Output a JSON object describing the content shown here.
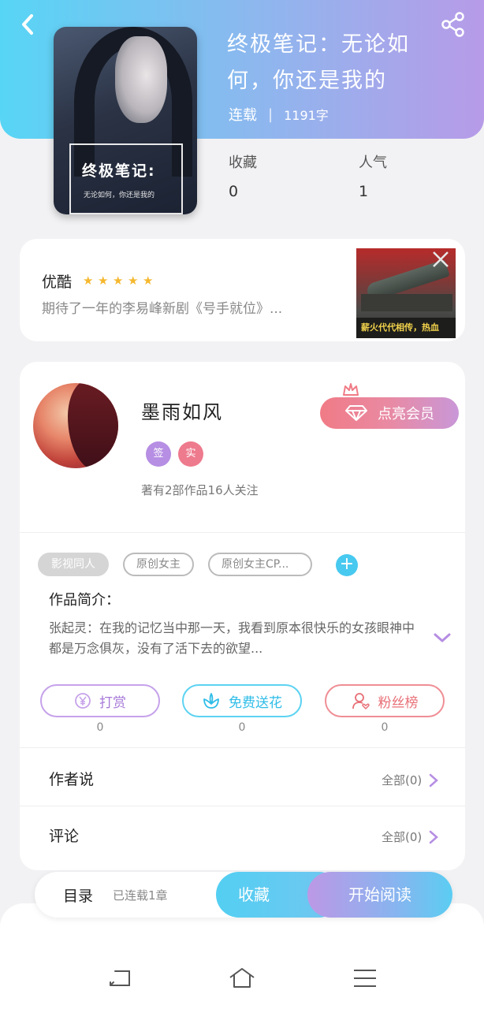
{
  "header": {
    "book_title": "终极笔记：无论如何，你还是我的",
    "status": "连载",
    "word_count": "1191字",
    "cover": {
      "title": "终极笔记:",
      "subtitle": "无论如何，你还是我的"
    }
  },
  "stats": {
    "favorites_label": "收藏",
    "favorites_value": "0",
    "popularity_label": "人气",
    "popularity_value": "1"
  },
  "ad": {
    "brand": "优酷",
    "rating": 5,
    "description": "期待了一年的李易峰新剧《号手就位》...",
    "image_caption": "薪火代代相传，热血"
  },
  "author": {
    "name": "墨雨如风",
    "vip_button": "点亮会员",
    "badges": [
      "签",
      "实"
    ],
    "stats_text": "著有2部作品16人关注"
  },
  "tags": [
    "影视同人",
    "原创女主",
    "原创女主CP..."
  ],
  "intro": {
    "label": "作品简介：",
    "text": "张起灵：在我的记忆当中那一天，我看到原本很快乐的女孩眼神中都是万念俱灰，没有了活下去的欲望..."
  },
  "actions": [
    {
      "label": "打赏",
      "icon": "yen-icon",
      "count": "0"
    },
    {
      "label": "免费送花",
      "icon": "flower-icon",
      "count": "0"
    },
    {
      "label": "粉丝榜",
      "icon": "fans-icon",
      "count": "0"
    }
  ],
  "sections": [
    {
      "label": "作者说",
      "right": "全部(0)"
    },
    {
      "label": "评论",
      "right": "全部(0)"
    }
  ],
  "bottom_bar": {
    "toc": "目录",
    "progress": "已连载1章",
    "collect": "收藏",
    "read": "开始阅读"
  },
  "colors": {
    "header_start": "#57d5f5",
    "header_end": "#b79be8",
    "accent_blue": "#48c9f0",
    "accent_pink": "#f07b86",
    "accent_purple": "#b68ee3"
  }
}
